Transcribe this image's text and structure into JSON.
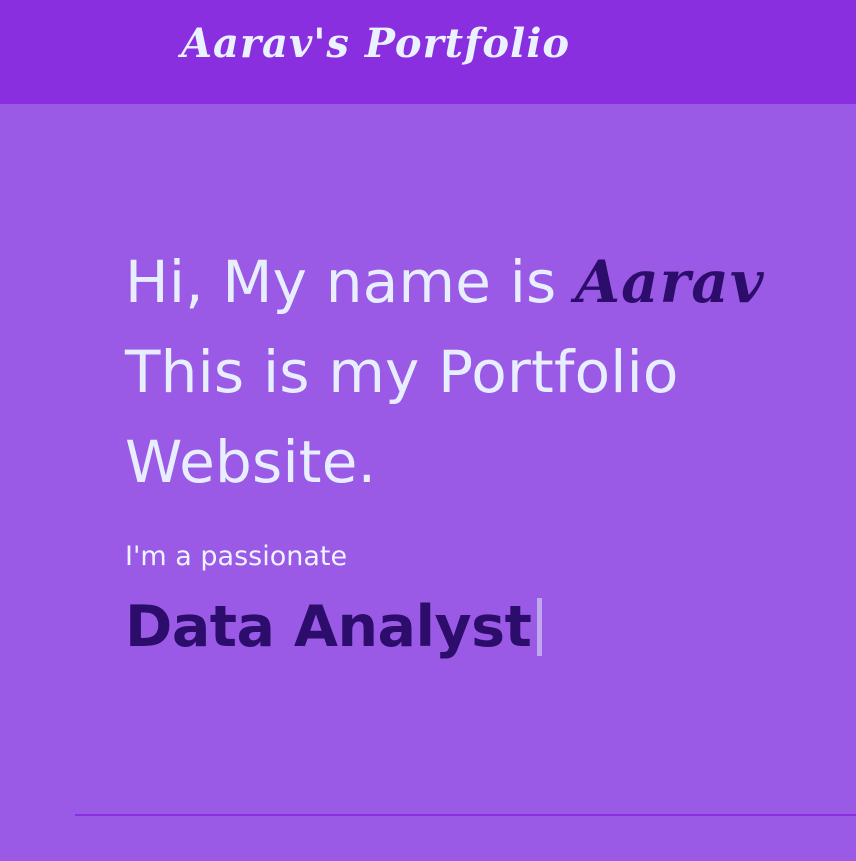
{
  "header": {
    "brand": "Aarav's Portfolio"
  },
  "hero": {
    "intro_prefix": "Hi, My name is ",
    "name": "Aarav",
    "line2": "This is my Portfolio",
    "line3": "Website."
  },
  "about": {
    "subtitle": "I'm a passionate",
    "role": "Data Analyst"
  },
  "colors": {
    "header_bg": "#8a2fe0",
    "page_bg": "#9b5ae6",
    "text_light": "#e7efff",
    "accent_dark": "#2c0d6b"
  }
}
